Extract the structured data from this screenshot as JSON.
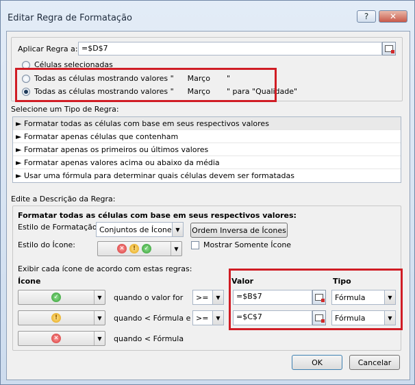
{
  "window": {
    "title": "Editar Regra de Formatação",
    "help_label": "?",
    "close_label": "✕"
  },
  "apply": {
    "label": "Aplicar Regra a:",
    "value": "=$D$7"
  },
  "scope": {
    "opt1": "Células selecionadas",
    "opt2_text": "Todas as células mostrando valores \"",
    "opt2_val": "Março",
    "opt2_tail": "\"",
    "opt3_text": "Todas as células mostrando valores \"",
    "opt3_val": "Março",
    "opt3_tail": "\" para \"Qualidade\""
  },
  "rule_type": {
    "header": "Selecione um Tipo de Regra:",
    "items": [
      "► Formatar todas as células com base em seus respectivos valores",
      "► Formatar apenas células que contenham",
      "► Formatar apenas os primeiros ou últimos valores",
      "► Formatar apenas valores acima ou abaixo da média",
      "► Usar uma fórmula para determinar quais células devem ser formatadas"
    ]
  },
  "desc": {
    "header": "Edite a Descrição da Regra:",
    "bold_title": "Formatar todas as células com base em seus respectivos valores:",
    "style_label": "Estilo de Formatação:",
    "style_value": "Conjuntos de Ícones",
    "reverse_btn": "Ordem Inversa de Ícones",
    "icon_style_label": "Estilo do Ícone:",
    "show_icon_only": "Mostrar Somente Ícone",
    "rules_intro": "Exibir cada ícone de acordo com estas regras:",
    "col_icon": "Ícone",
    "col_value": "Valor",
    "col_type": "Tipo",
    "rows": [
      {
        "condition": "quando o valor for",
        "op": ">=",
        "value": "=$B$7",
        "type": "Fórmula"
      },
      {
        "condition": "quando < Fórmula e",
        "op": ">=",
        "value": "=$C$7",
        "type": "Fórmula"
      },
      {
        "condition": "quando < Fórmula"
      }
    ]
  },
  "footer": {
    "ok": "OK",
    "cancel": "Cancelar"
  },
  "colors": {
    "highlight": "#d01c24"
  }
}
